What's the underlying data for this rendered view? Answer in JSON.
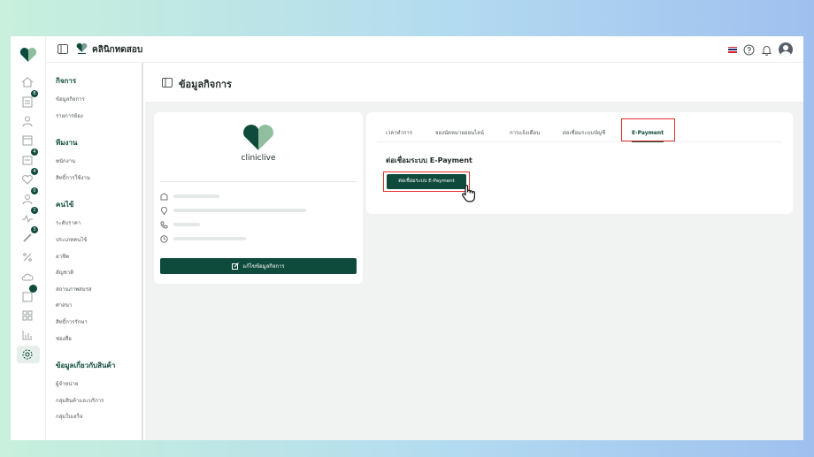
{
  "header": {
    "clinic_name": "คลินิกทดสอบ",
    "icons": [
      "panel-toggle-icon",
      "thai-flag-icon",
      "help-icon",
      "bell-icon",
      "avatar"
    ]
  },
  "rail": {
    "icons": [
      "home-icon",
      "documents-icon",
      "user-icon",
      "calendar-icon",
      "list-icon",
      "heart-icon",
      "patient-icon",
      "health-icon",
      "syringe-icon",
      "percent-icon",
      "cloud-icon",
      "clipboard-icon",
      "grid-icon",
      "chart-icon",
      "settings-icon"
    ],
    "badges": [
      "8",
      "4",
      "4",
      "0",
      "2",
      "3"
    ]
  },
  "menu": {
    "sections": [
      {
        "title": "กิจการ",
        "items": [
          "ข้อมูลกิจการ",
          "รายการห้อง"
        ]
      },
      {
        "title": "ทีมงาน",
        "items": [
          "พนักงาน",
          "สิทธิ์การใช้งาน"
        ]
      },
      {
        "title": "คนไข้",
        "items": [
          "ระดับราคา",
          "ประเภทคนไข้",
          "อาชีพ",
          "สัญชาติ",
          "สถานภาพสมรส",
          "ศาสนา",
          "สิทธิ์การรักษา",
          "ช่องสื่อ"
        ]
      },
      {
        "title": "ข้อมูลเกี่ยวกับสินค้า",
        "items": [
          "ผู้จำหน่าย",
          "กลุ่มสินค้าและบริการ",
          "กลุ่มใบเสร็จ"
        ]
      }
    ]
  },
  "page": {
    "title": "ข้อมูลกิจการ",
    "brand_name": "cliniclive",
    "edit_button": "แก้ไขข้อมูลกิจการ",
    "info_icons": [
      "building-icon",
      "location-icon",
      "phone-icon",
      "clock-icon"
    ]
  },
  "tabs": [
    {
      "label": "เวลาทำการ",
      "active": false
    },
    {
      "label": "จองนัดหมายออนไลน์",
      "active": false
    },
    {
      "label": "การแจ้งเตือน",
      "active": false
    },
    {
      "label": "ต่อเชื่อมระบบบัญชี",
      "active": false
    },
    {
      "label": "E-Payment",
      "active": true
    }
  ],
  "epayment": {
    "section_title": "ต่อเชื่อมระบบ E-Payment",
    "connect_button": "ต่อเชื่อมระบบ E-Payment"
  },
  "colors": {
    "brand": "#0f4b3c",
    "brand_light": "#8fbf9f",
    "highlight": "#e0312e",
    "page_bg": "#f1f3f2"
  }
}
